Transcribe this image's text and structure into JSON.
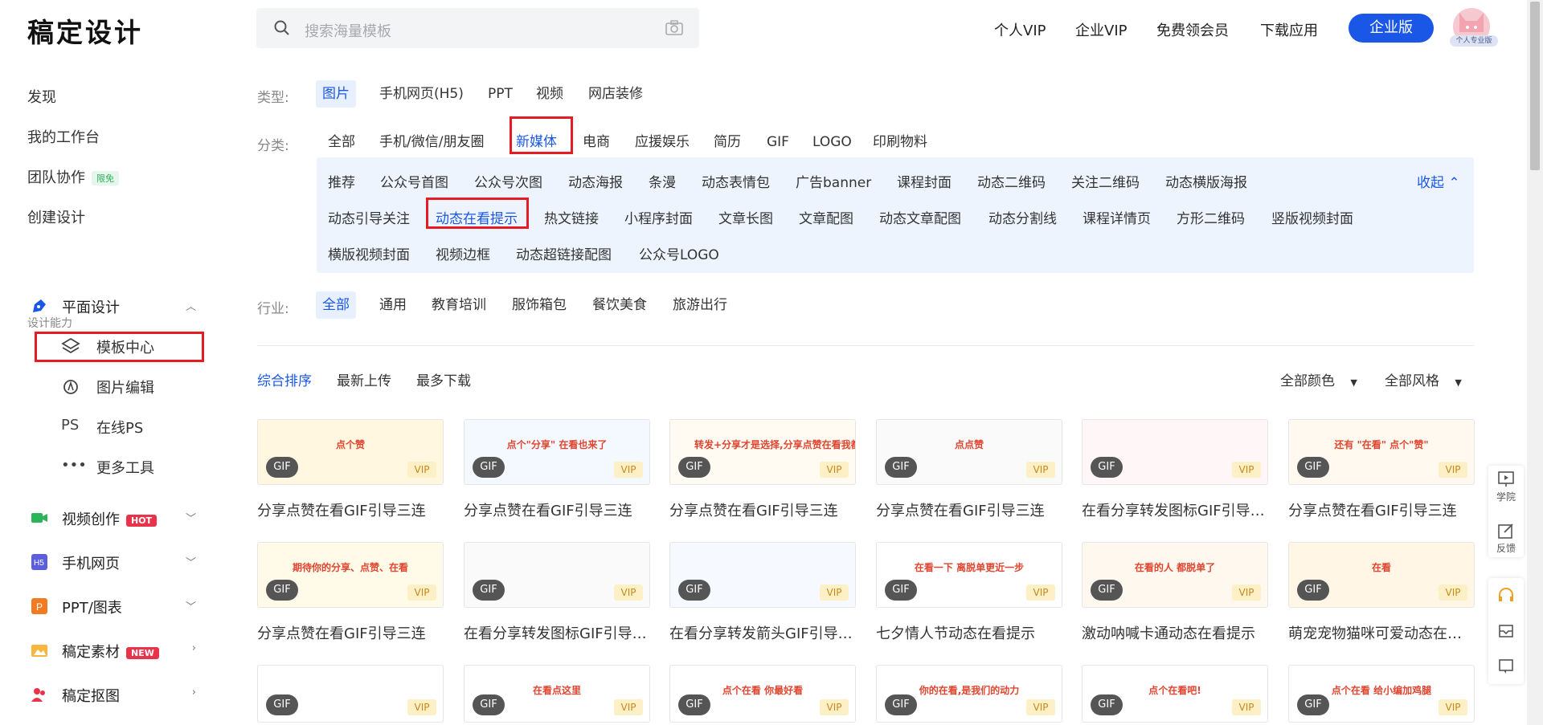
{
  "header": {
    "logo": "稿定设计",
    "search_placeholder": "搜索海量模板",
    "nav": [
      "个人VIP",
      "企业VIP",
      "免费领会员",
      "下载应用"
    ],
    "enterprise_button": "企业版",
    "avatar_badge": "个人专业版"
  },
  "sidebar": {
    "top_links": [
      "发现",
      "我的工作台",
      "团队协作",
      "创建设计"
    ],
    "team_badge": "限免",
    "caption": "设计能力",
    "graphic_design": "平面设计",
    "sub_items": [
      "模板中心",
      "图片编辑",
      "在线PS",
      "更多工具"
    ],
    "ps_icon_text": "PS",
    "sections": [
      {
        "label": "视频创作",
        "badge": "HOT"
      },
      {
        "label": "手机网页",
        "badge": ""
      },
      {
        "label": "PPT/图表",
        "badge": ""
      },
      {
        "label": "稿定素材",
        "badge": "NEW"
      },
      {
        "label": "稿定抠图",
        "badge": ""
      }
    ],
    "h5_icon_text": "H5",
    "ppt_icon_text": "P"
  },
  "filters": {
    "type_label": "类型:",
    "types": [
      "图片",
      "手机网页(H5)",
      "PPT",
      "视频",
      "网店装修"
    ],
    "category_label": "分类:",
    "categories": [
      "全部",
      "手机/微信/朋友圈",
      "新媒体",
      "电商",
      "应援娱乐",
      "简历",
      "GIF",
      "LOGO",
      "印刷物料"
    ],
    "sub_categories_row1": [
      "推荐",
      "公众号首图",
      "公众号次图",
      "动态海报",
      "条漫",
      "动态表情包",
      "广告banner",
      "课程封面",
      "动态二维码",
      "关注二维码",
      "动态横版海报"
    ],
    "sub_categories_row2": [
      "动态引导关注",
      "动态在看提示",
      "热文链接",
      "小程序封面",
      "文章长图",
      "文章配图",
      "动态文章配图",
      "动态分割线",
      "课程详情页",
      "方形二维码",
      "竖版视频封面"
    ],
    "sub_categories_row3": [
      "横版视频封面",
      "视频边框",
      "动态超链接配图",
      "公众号LOGO"
    ],
    "collapse": "收起",
    "industry_label": "行业:",
    "industries": [
      "全部",
      "通用",
      "教育培训",
      "服饰箱包",
      "餐饮美食",
      "旅游出行"
    ]
  },
  "sort": {
    "options": [
      "综合排序",
      "最新上传",
      "最多下载"
    ],
    "color_filter": "全部颜色",
    "style_filter": "全部风格"
  },
  "cards": [
    {
      "title": "分享点赞在看GIF引导三连",
      "art_text": "点个赞"
    },
    {
      "title": "分享点赞在看GIF引导三连",
      "art_text": "点个\"分享\"  在看也来了"
    },
    {
      "title": "分享点赞在看GIF引导三连",
      "art_text": "转发+分享才是选择,分享点赞在看我都要!"
    },
    {
      "title": "分享点赞在看GIF引导三连",
      "art_text": "点点赞"
    },
    {
      "title": "在看分享转发图标GIF引导三连",
      "art_text": ""
    },
    {
      "title": "分享点赞在看GIF引导三连",
      "art_text": "还有 \"在看\"  点个\"赞\""
    },
    {
      "title": "分享点赞在看GIF引导三连",
      "art_text": "期待你的分享、点赞、在看"
    },
    {
      "title": "在看分享转发图标GIF引导三连",
      "art_text": ""
    },
    {
      "title": "在看分享转发箭头GIF引导三连",
      "art_text": ""
    },
    {
      "title": "七夕情人节动态在看提示",
      "art_text": "在看一下 离脱单更近一步"
    },
    {
      "title": "激动呐喊卡通动态在看提示",
      "art_text": "在看的人 都脱单了"
    },
    {
      "title": "萌宠宠物猫咪可爱动态在看提示",
      "art_text": "在看"
    },
    {
      "title": "",
      "art_text": ""
    },
    {
      "title": "",
      "art_text": "在看点这里"
    },
    {
      "title": "",
      "art_text": "点个在看 你最好看"
    },
    {
      "title": "",
      "art_text": "你的在看,是我们的动力"
    },
    {
      "title": "",
      "art_text": "点个在看吧!"
    },
    {
      "title": "",
      "art_text": "点个在看 给小编加鸡腿"
    }
  ],
  "badges": {
    "gif": "GIF",
    "vip": "VIP"
  },
  "float_panel": [
    "学院",
    "反馈"
  ],
  "colors": {
    "accent": "#1a57e6",
    "highlight_box": "#e51c23",
    "vip_bg": "#fdf0c7"
  }
}
